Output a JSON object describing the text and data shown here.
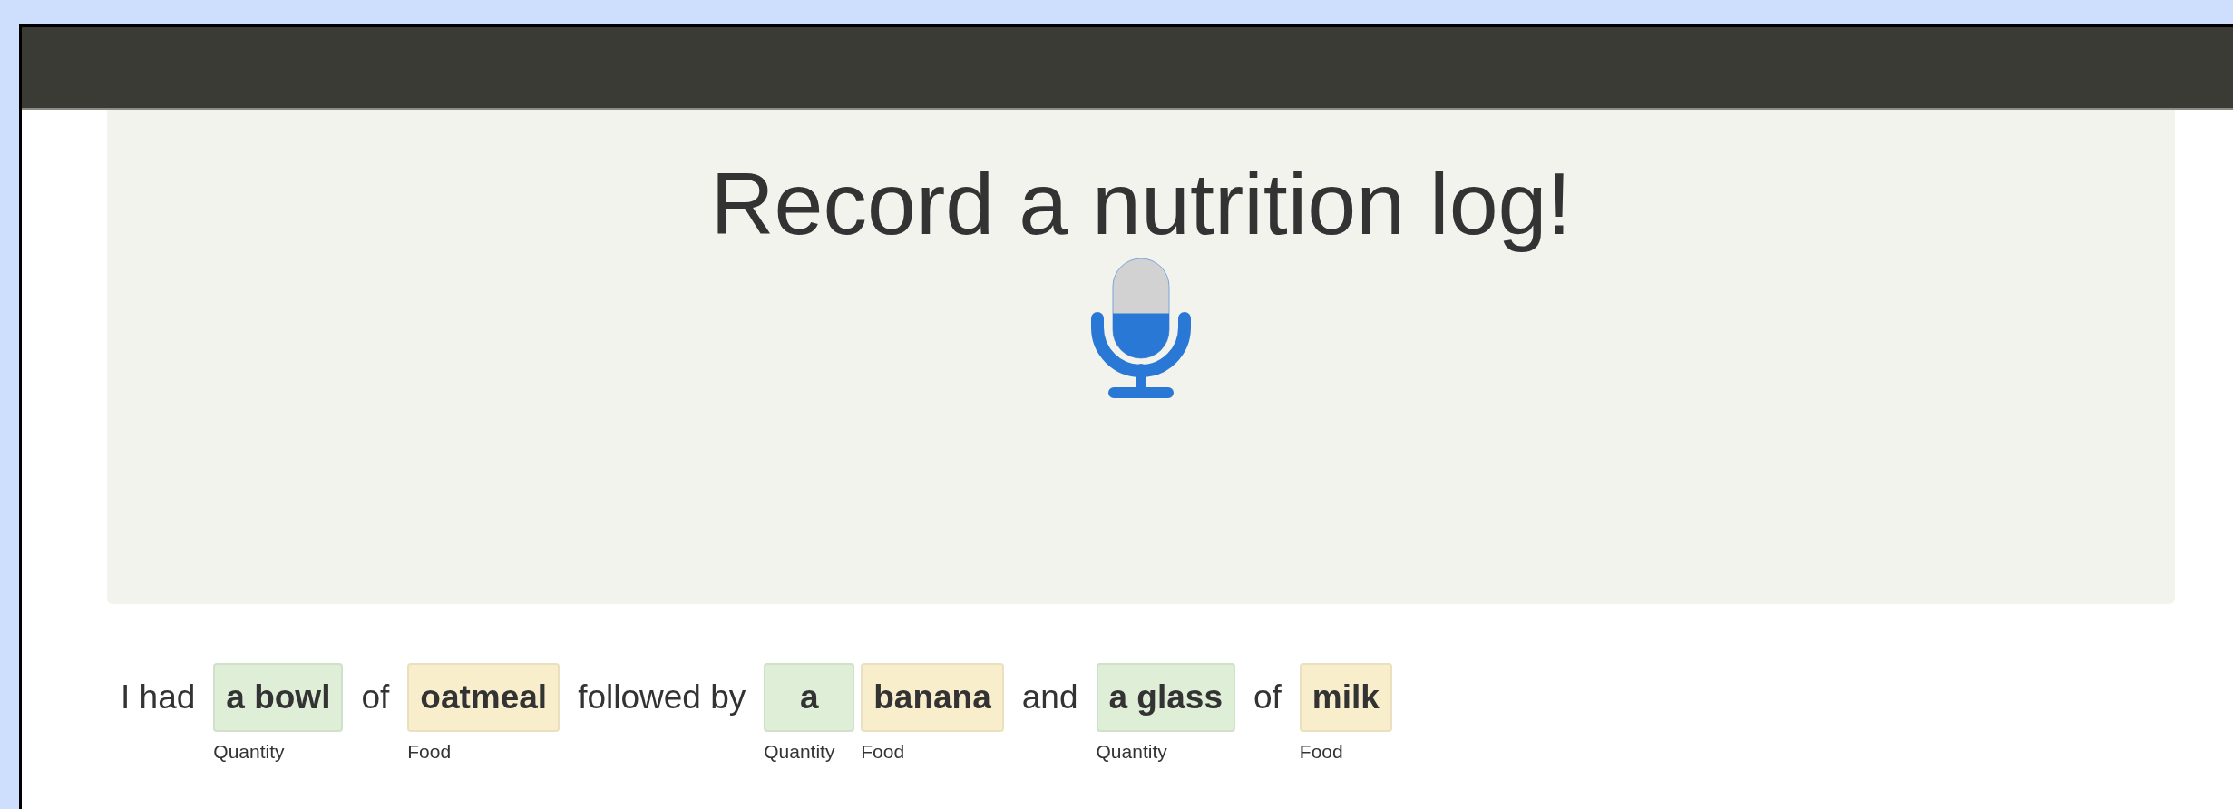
{
  "header": {
    "title": "Record a nutrition log!"
  },
  "microphone": {
    "level": 0.45
  },
  "sentence": [
    {
      "kind": "text",
      "text": "I had"
    },
    {
      "kind": "entity",
      "text": "a bowl",
      "label": "Quantity",
      "color": "#dfeed7"
    },
    {
      "kind": "text",
      "text": "of"
    },
    {
      "kind": "entity",
      "text": "oatmeal",
      "label": "Food",
      "color": "#f9eecc"
    },
    {
      "kind": "text",
      "text": "followed by"
    },
    {
      "kind": "entity",
      "text": "a",
      "label": "Quantity",
      "color": "#dfeed7"
    },
    {
      "kind": "entity",
      "text": "banana",
      "label": "Food",
      "color": "#f9eecc"
    },
    {
      "kind": "text",
      "text": "and"
    },
    {
      "kind": "entity",
      "text": "a glass",
      "label": "Quantity",
      "color": "#dfeed7"
    },
    {
      "kind": "text",
      "text": "of"
    },
    {
      "kind": "entity",
      "text": "milk",
      "label": "Food",
      "color": "#f9eecc"
    }
  ]
}
